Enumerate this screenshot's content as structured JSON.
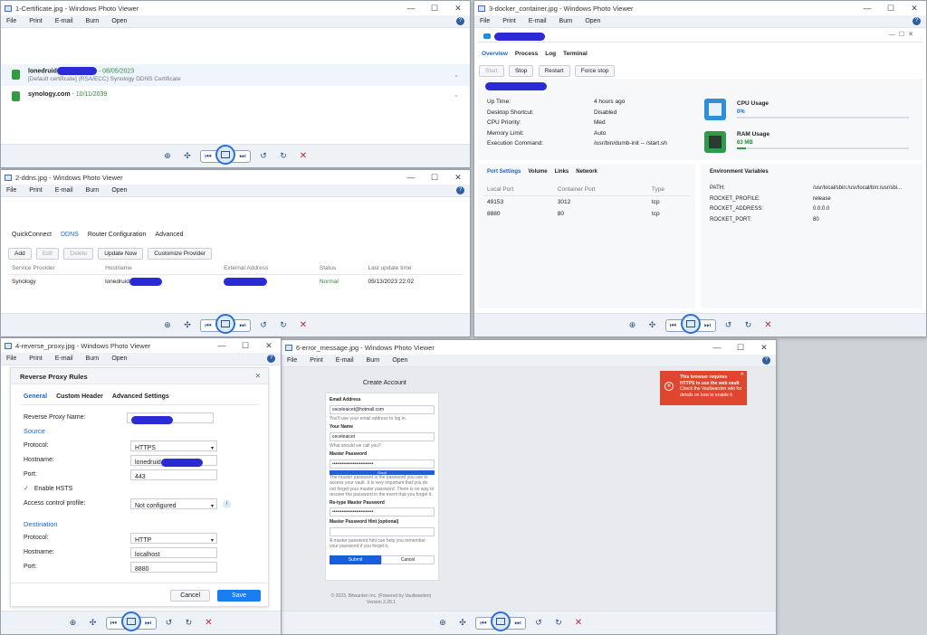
{
  "menus": [
    "File",
    "Print",
    "E-mail",
    "Burn",
    "Open"
  ],
  "w1": {
    "title": "1-Certificate.jpg - Windows Photo Viewer",
    "cert1": {
      "name": "lonedruid",
      "date": "08/05/2023",
      "desc": "[Default certificate] (RSA/ECC) Synology DDNS Certificate"
    },
    "cert2": {
      "name": "synology.com",
      "date": "10/11/2039"
    }
  },
  "w2": {
    "title": "2-ddns.jpg - Windows Photo Viewer",
    "tabs": [
      "QuickConnect",
      "DDNS",
      "Router Configuration",
      "Advanced"
    ],
    "buttons": [
      "Add",
      "Edit",
      "Delete",
      "Update Now",
      "Customize Provider"
    ],
    "headers": [
      "Service Provider",
      "Hostname",
      "External Address",
      "Status",
      "Last update time"
    ],
    "row": {
      "provider": "Synology",
      "hostname": "lonedruid",
      "status": "Normal",
      "time": "05/13/2023 22:02"
    }
  },
  "w3": {
    "title": "3-docker_container.jpg - Windows Photo Viewer",
    "tabs": [
      "Overview",
      "Process",
      "Log",
      "Terminal"
    ],
    "buttons": [
      "Start",
      "Stop",
      "Restart",
      "Force stop"
    ],
    "info": [
      {
        "k": "Up Time:",
        "v": "4 hours ago"
      },
      {
        "k": "Desktop Shortcut:",
        "v": "Disabled"
      },
      {
        "k": "CPU Priority:",
        "v": "Med"
      },
      {
        "k": "Memory Limit:",
        "v": "Auto"
      },
      {
        "k": "Execution Command:",
        "v": "/usr/bin/dumb-init -- /start.sh"
      }
    ],
    "cpu": {
      "label": "CPU Usage",
      "value": "0%"
    },
    "ram": {
      "label": "RAM Usage",
      "value": "63 MB"
    },
    "port_tabs": [
      "Port Settings",
      "Volume",
      "Links",
      "Network"
    ],
    "port_headers": [
      "Local Port",
      "Container Port",
      "Type"
    ],
    "ports": [
      {
        "local": "49153",
        "container": "3012",
        "type": "tcp"
      },
      {
        "local": "8880",
        "container": "80",
        "type": "tcp"
      }
    ],
    "env_title": "Environment Variables",
    "env": [
      {
        "k": "PATH:",
        "v": "/usr/local/sbin:/usr/local/bin:/usr/sbi..."
      },
      {
        "k": "ROCKET_PROFILE:",
        "v": "release"
      },
      {
        "k": "ROCKET_ADDRESS:",
        "v": "0.0.0.0"
      },
      {
        "k": "ROCKET_PORT:",
        "v": "80"
      }
    ]
  },
  "w4": {
    "title": "4-reverse_proxy.jpg - Windows Photo Viewer",
    "dialog_title": "Reverse Proxy Rules",
    "tabs": [
      "General",
      "Custom Header",
      "Advanced Settings"
    ],
    "name_label": "Reverse Proxy Name:",
    "source": "Source",
    "protocol_label": "Protocol:",
    "hostname_label": "Hostname:",
    "port_label": "Port:",
    "src_protocol": "HTTPS",
    "src_hostname": "lonedruid",
    "src_port": "443",
    "hsts": "Enable HSTS",
    "acl_label": "Access control profile:",
    "acl_value": "Not configured",
    "destination": "Destination",
    "dst_protocol": "HTTP",
    "dst_hostname": "localhost",
    "dst_port": "8880",
    "cancel": "Cancel",
    "save": "Save"
  },
  "w5": {
    "title": "6-error_message.jpg - Windows Photo Viewer",
    "heading": "Create Account",
    "email_label": "Email Address",
    "email_value": "ceceleaicet@hotmail.com",
    "email_hint": "You'll use your email address to log in.",
    "name_label": "Your Name",
    "name_value": "ceceleaicet",
    "name_hint": "What should we call you?",
    "mp_label": "Master Password",
    "mp_value": "••••••••••••••••••••••••••",
    "strength": "Good",
    "mp_hint": "The master password is the password you use to access your vault. It is very important that you do not forget your master password. There is no way to recover the password in the event that you forget it.",
    "retype_label": "Re-type Master Password",
    "retype_value": "••••••••••••••••••••••••••",
    "hint_label": "Master Password Hint (optional)",
    "hint_hint": "A master password hint can help you remember your password if you forget it.",
    "submit": "Submit",
    "cancel": "Cancel",
    "footer1": "© 2023, Bitwarden Inc. (Powered by Vaultwarden)",
    "footer2": "Version 2.28.1",
    "error_title": "This browser requires HTTPS to use the web vault",
    "error_body": "Check the Vaultwarden wiki for details on how to enable it"
  },
  "controls": {
    "min": "—",
    "max": "☐",
    "close": "✕"
  }
}
